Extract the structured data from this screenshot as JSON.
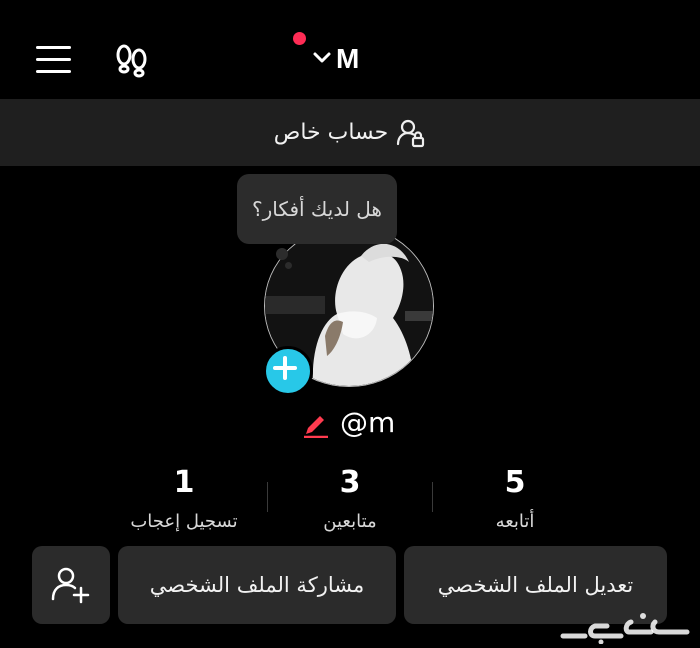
{
  "header": {
    "account_name": "M",
    "icons": [
      "menu-icon",
      "footprints-icon",
      "chevron-down-icon"
    ],
    "notification_color": "#fe2c55"
  },
  "banner": {
    "label": "حساب خاص",
    "icon": "private-account-icon"
  },
  "bubble": {
    "text": "هل لديك أفكار؟"
  },
  "profile": {
    "username": "@m"
  },
  "stats": [
    {
      "label": "تسجيل إعجاب",
      "value": "1"
    },
    {
      "label": "متابعين",
      "value": "3"
    },
    {
      "label": "أتابعه",
      "value": "5"
    }
  ],
  "actions": {
    "edit_profile": "تعديل الملف الشخصي",
    "share_profile": "مشاركة الملف الشخصي"
  },
  "colors": {
    "accent_add": "#28c8e8",
    "button_bg": "#2b2b2b",
    "banner_bg": "#1f1f1f"
  }
}
